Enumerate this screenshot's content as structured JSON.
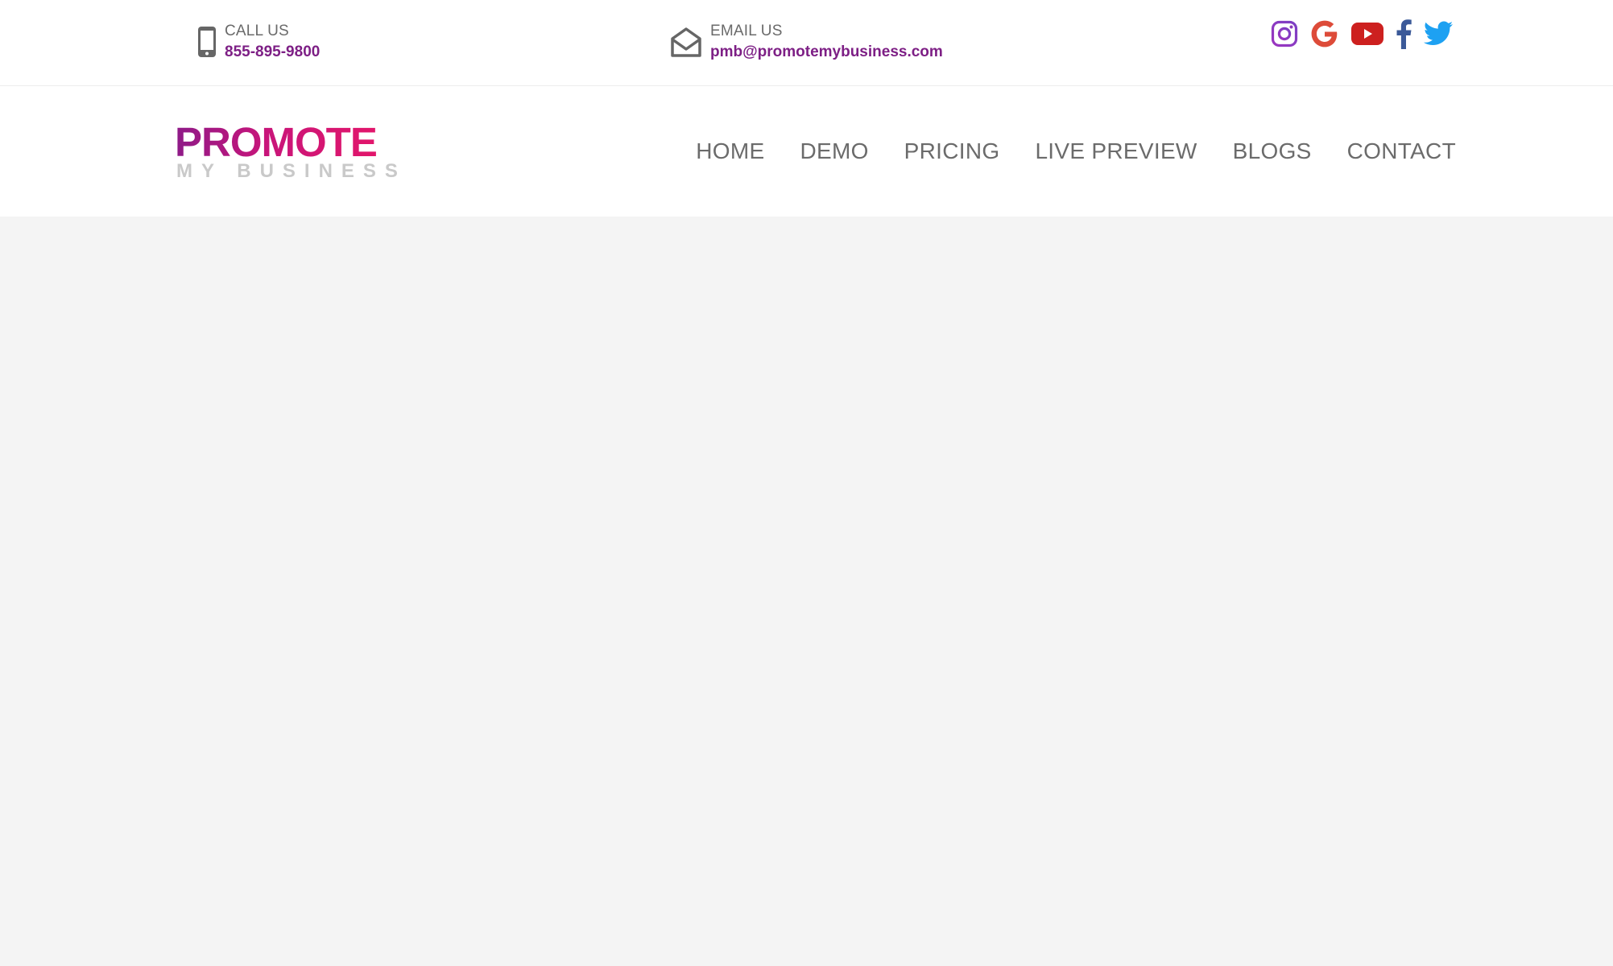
{
  "contact": {
    "call": {
      "label": "CALL US",
      "value": "855-895-9800",
      "icon": "mobile-phone-icon"
    },
    "email": {
      "label": "EMAIL US",
      "value": "pmb@promotemybusiness.com",
      "icon": "open-envelope-icon"
    }
  },
  "social": [
    {
      "name": "instagram",
      "icon": "instagram-icon",
      "color": "#8a3ab9"
    },
    {
      "name": "google",
      "icon": "google-icon",
      "color": "#dd4b39"
    },
    {
      "name": "youtube",
      "icon": "youtube-icon",
      "color": "#cd201f"
    },
    {
      "name": "facebook",
      "icon": "facebook-icon",
      "color": "#3b5998"
    },
    {
      "name": "twitter",
      "icon": "twitter-icon",
      "color": "#1da1f2"
    }
  ],
  "logo": {
    "line1": "PROMOTE",
    "line2": "MY BUSINESS"
  },
  "nav": {
    "items": [
      {
        "label": "HOME"
      },
      {
        "label": "DEMO"
      },
      {
        "label": "PRICING"
      },
      {
        "label": "LIVE PREVIEW"
      },
      {
        "label": "BLOGS"
      },
      {
        "label": "CONTACT"
      }
    ]
  },
  "colors": {
    "accent": "#7d1f85",
    "nav_text": "#6b6b6b",
    "background": "#f4f4f4"
  }
}
